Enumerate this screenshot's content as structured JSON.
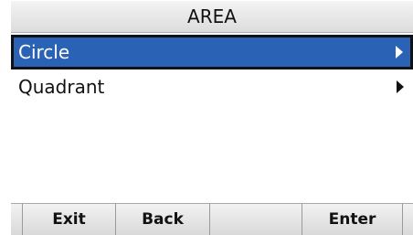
{
  "title": "AREA",
  "menu": {
    "items": [
      {
        "label": "Circle",
        "selected": true
      },
      {
        "label": "Quadrant",
        "selected": false
      }
    ]
  },
  "softkeys": {
    "k1": "Exit",
    "k2": "Back",
    "k3": "",
    "k4": "Enter"
  },
  "colors": {
    "selection": "#2a62b6"
  }
}
